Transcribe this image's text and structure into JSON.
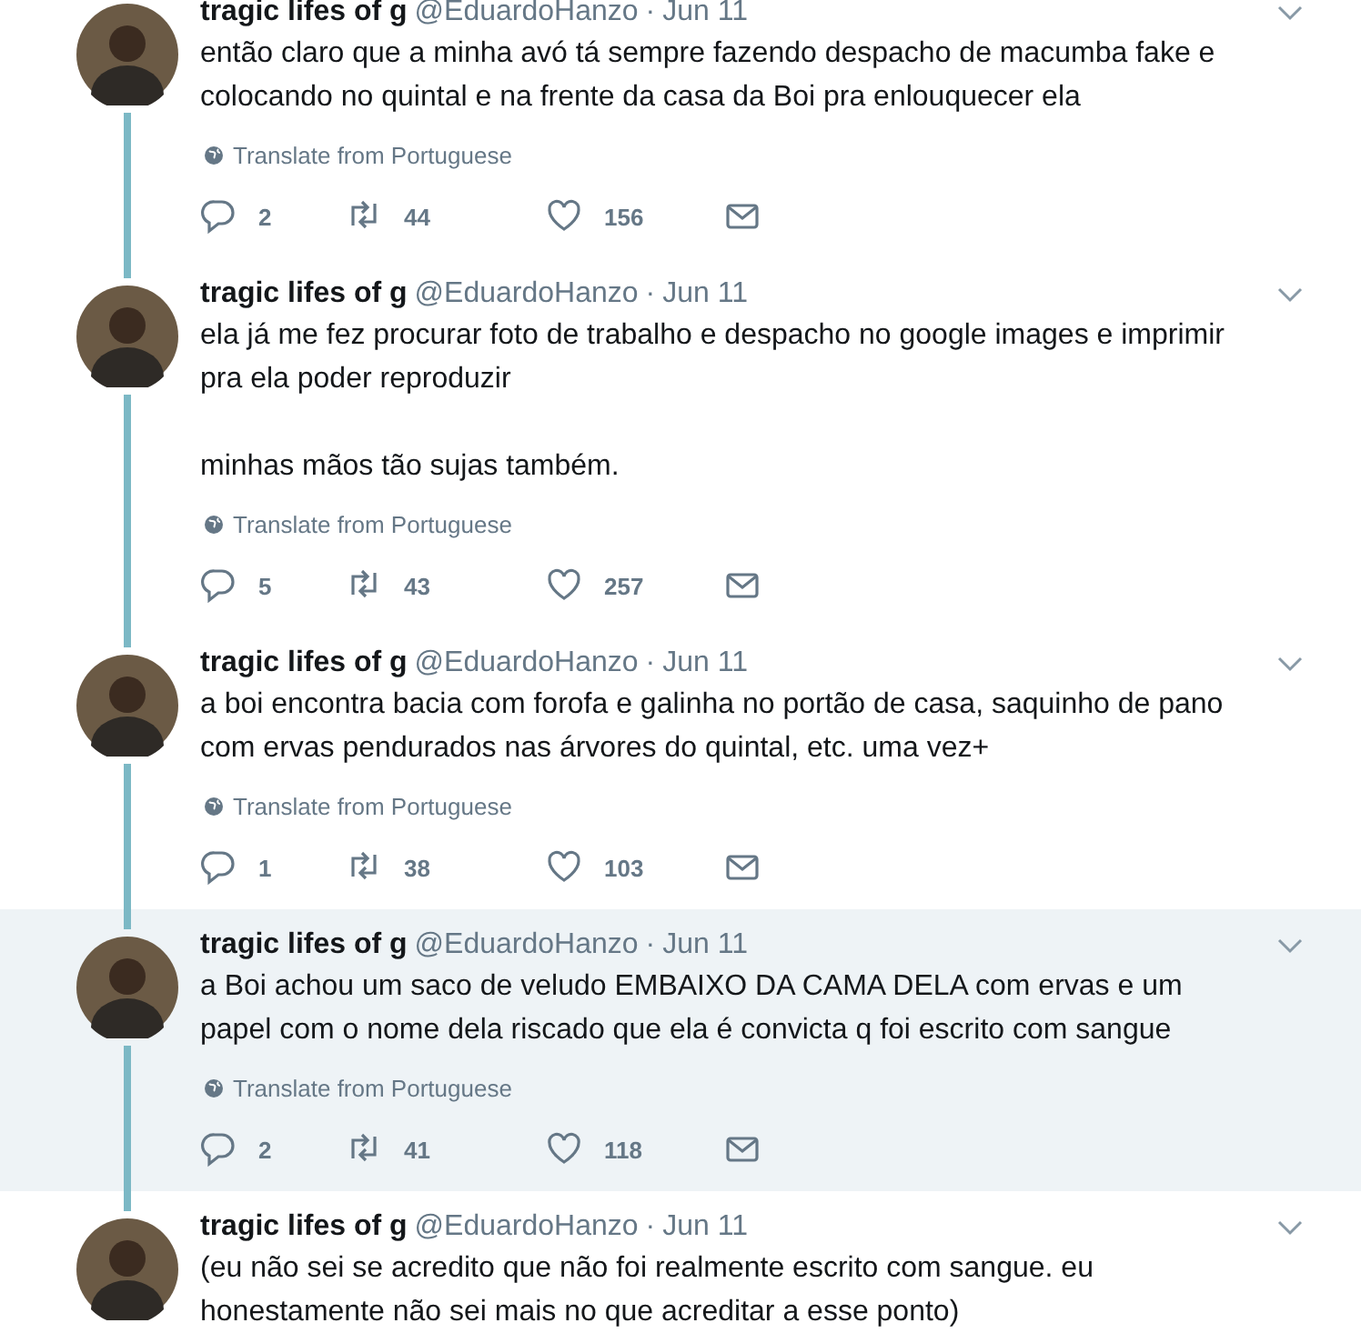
{
  "tweets": [
    {
      "name": "tragic lifes of g",
      "handle": "@EduardoHanzo",
      "sep": "·",
      "date": "Jun 11",
      "highlighted": false,
      "paragraphs": [
        "então claro que a minha avó tá sempre fazendo despacho de macumba fake e colocando no quintal e na frente da casa da Boi pra enlouquecer ela"
      ],
      "translate": "Translate from Portuguese",
      "replies": "2",
      "retweets": "44",
      "likes": "156"
    },
    {
      "name": "tragic lifes of g",
      "handle": "@EduardoHanzo",
      "sep": "·",
      "date": "Jun 11",
      "highlighted": false,
      "paragraphs": [
        "ela já me fez procurar foto de trabalho e despacho no google images e imprimir pra ela poder reproduzir",
        "minhas mãos tão sujas também."
      ],
      "translate": "Translate from Portuguese",
      "replies": "5",
      "retweets": "43",
      "likes": "257"
    },
    {
      "name": "tragic lifes of g",
      "handle": "@EduardoHanzo",
      "sep": "·",
      "date": "Jun 11",
      "highlighted": false,
      "paragraphs": [
        "a boi encontra bacia com forofa e galinha no portão de casa, saquinho de pano com ervas pendurados nas árvores do quintal, etc. uma vez+"
      ],
      "translate": "Translate from Portuguese",
      "replies": "1",
      "retweets": "38",
      "likes": "103"
    },
    {
      "name": "tragic lifes of g",
      "handle": "@EduardoHanzo",
      "sep": "·",
      "date": "Jun 11",
      "highlighted": true,
      "paragraphs": [
        "a Boi achou um saco de veludo EMBAIXO DA CAMA DELA com ervas e um papel com o nome dela riscado que ela é convicta q foi escrito com sangue"
      ],
      "translate": "Translate from Portuguese",
      "replies": "2",
      "retweets": "41",
      "likes": "118"
    },
    {
      "name": "tragic lifes of g",
      "handle": "@EduardoHanzo",
      "sep": "·",
      "date": "Jun 11",
      "highlighted": false,
      "paragraphs": [
        "(eu não sei se acredito que não foi realmente escrito com sangue. eu honestamente não sei mais no que acreditar a esse ponto)"
      ]
    }
  ]
}
